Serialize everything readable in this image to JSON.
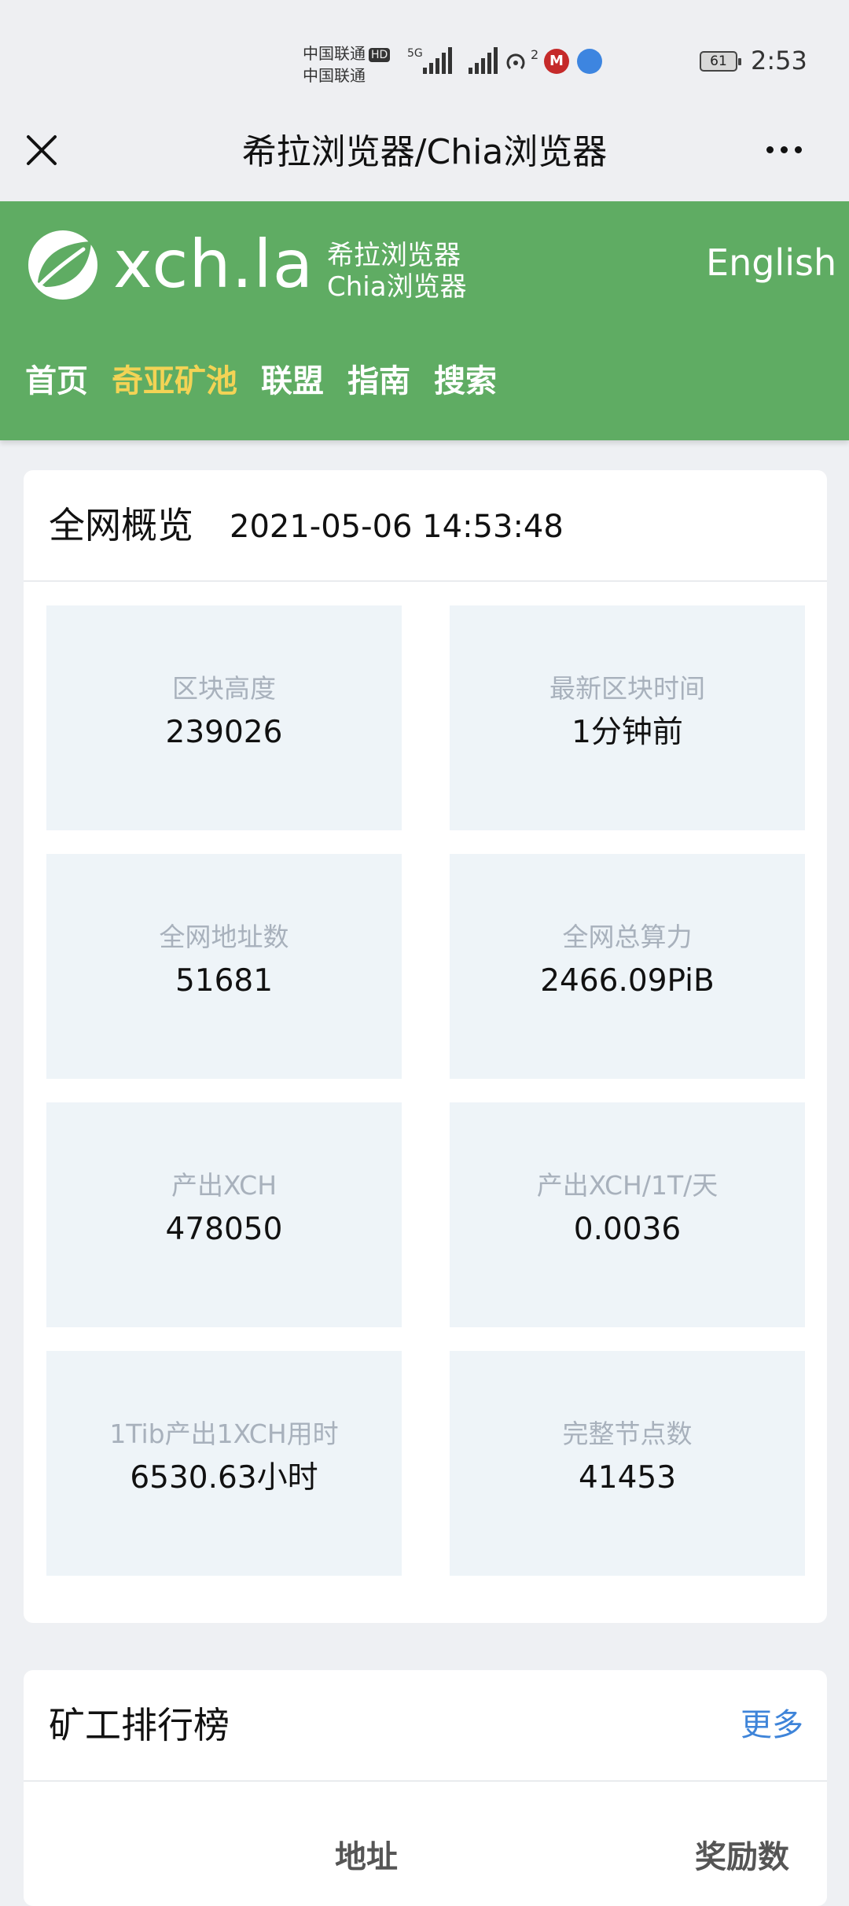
{
  "status_bar": {
    "carrier_1": "中国联通",
    "carrier_1_badge": "HD",
    "carrier_2": "中国联通",
    "network": "5G",
    "hotspot_count": "2",
    "battery": "61",
    "time": "2:53"
  },
  "nav": {
    "title": "希拉浏览器/Chia浏览器",
    "close_icon": "close-icon",
    "more_icon": "more-icon"
  },
  "site": {
    "logo": "xch.la",
    "subtitle_1": "希拉浏览器",
    "subtitle_2": "Chia浏览器",
    "lang": "English",
    "menu": [
      {
        "label": "首页",
        "active": false
      },
      {
        "label": "奇亚矿池",
        "active": true
      },
      {
        "label": "联盟",
        "active": false
      },
      {
        "label": "指南",
        "active": false
      },
      {
        "label": "搜索",
        "active": false
      }
    ],
    "brand_color": "#5fac63",
    "active_color": "#f3d355"
  },
  "overview": {
    "title": "全网概览",
    "time": "2021-05-06 14:53:48",
    "stats": [
      {
        "label": "区块高度",
        "value": "239026"
      },
      {
        "label": "最新区块时间",
        "value": "1分钟前"
      },
      {
        "label": "全网地址数",
        "value": "51681"
      },
      {
        "label": "全网总算力",
        "value": "2466.09PiB"
      },
      {
        "label": "产出XCH",
        "value": "478050"
      },
      {
        "label": "产出XCH/1T/天",
        "value": "0.0036"
      },
      {
        "label": "1Tib产出1XCH用时",
        "value": "6530.63小时"
      },
      {
        "label": "完整节点数",
        "value": "41453"
      }
    ]
  },
  "ranking": {
    "title": "矿工排行榜",
    "more": "更多",
    "columns": [
      "地址",
      "奖励数"
    ]
  }
}
